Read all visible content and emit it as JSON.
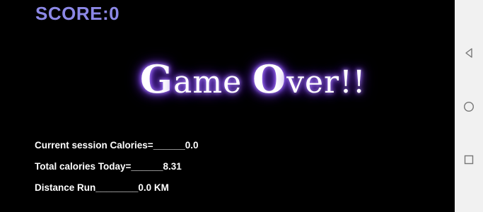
{
  "score": {
    "label": "SCORE:0"
  },
  "game_over": {
    "cap_g": "G",
    "text_1": "ame ",
    "cap_o": "O",
    "text_2": "ver!!"
  },
  "stats": {
    "current_session": "Current session Calories=______0.0",
    "total_today": "Total calories Today=______8.31",
    "distance_run": "Distance Run________0.0 KM"
  },
  "navbar": {
    "buttons": [
      "back-icon",
      "home-icon",
      "recents-icon"
    ]
  },
  "colors": {
    "score": "#8c88e6",
    "glow": "#8a4fff",
    "background": "#000000",
    "navbar": "#f1f1f1"
  }
}
